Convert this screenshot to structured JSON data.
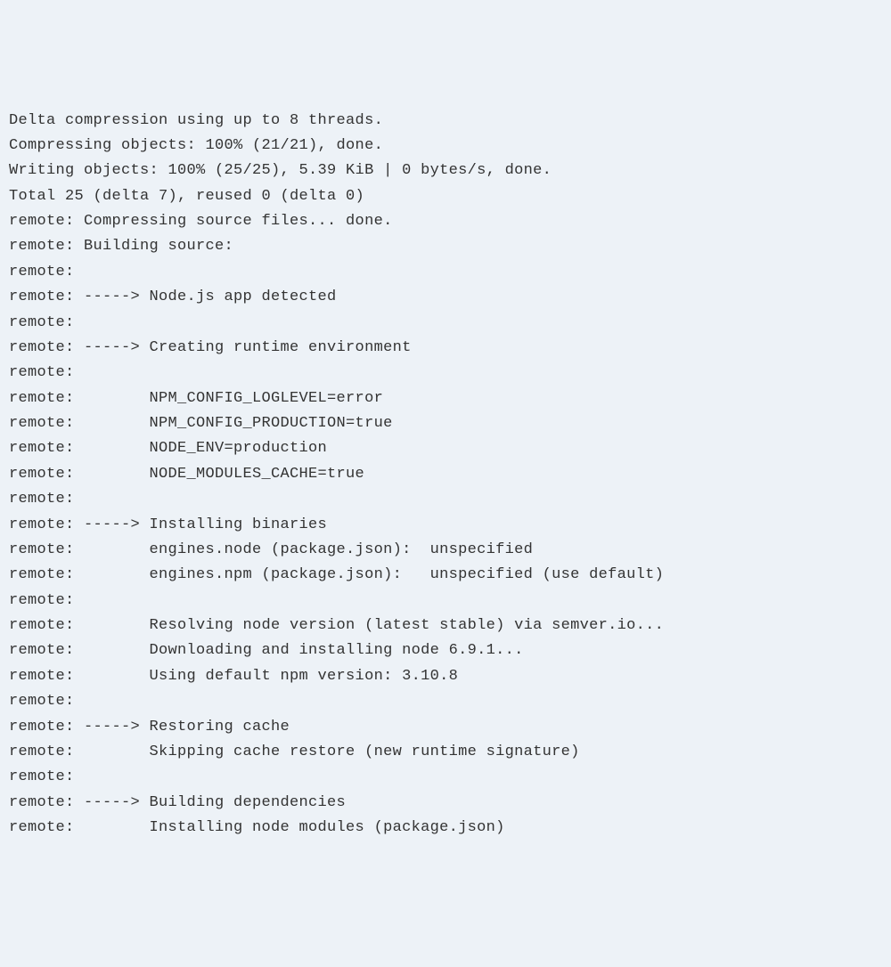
{
  "terminal": {
    "lines": [
      "Delta compression using up to 8 threads.",
      "Compressing objects: 100% (21/21), done.",
      "Writing objects: 100% (25/25), 5.39 KiB | 0 bytes/s, done.",
      "Total 25 (delta 7), reused 0 (delta 0)",
      "remote: Compressing source files... done.",
      "remote: Building source:",
      "remote:",
      "remote: -----> Node.js app detected",
      "remote:",
      "remote: -----> Creating runtime environment",
      "remote:",
      "remote:        NPM_CONFIG_LOGLEVEL=error",
      "remote:        NPM_CONFIG_PRODUCTION=true",
      "remote:        NODE_ENV=production",
      "remote:        NODE_MODULES_CACHE=true",
      "remote:",
      "remote: -----> Installing binaries",
      "remote:        engines.node (package.json):  unspecified",
      "remote:        engines.npm (package.json):   unspecified (use default)",
      "remote:",
      "remote:        Resolving node version (latest stable) via semver.io...",
      "remote:        Downloading and installing node 6.9.1...",
      "remote:        Using default npm version: 3.10.8",
      "remote:",
      "remote: -----> Restoring cache",
      "remote:        Skipping cache restore (new runtime signature)",
      "remote:",
      "remote: -----> Building dependencies",
      "remote:        Installing node modules (package.json)"
    ]
  }
}
